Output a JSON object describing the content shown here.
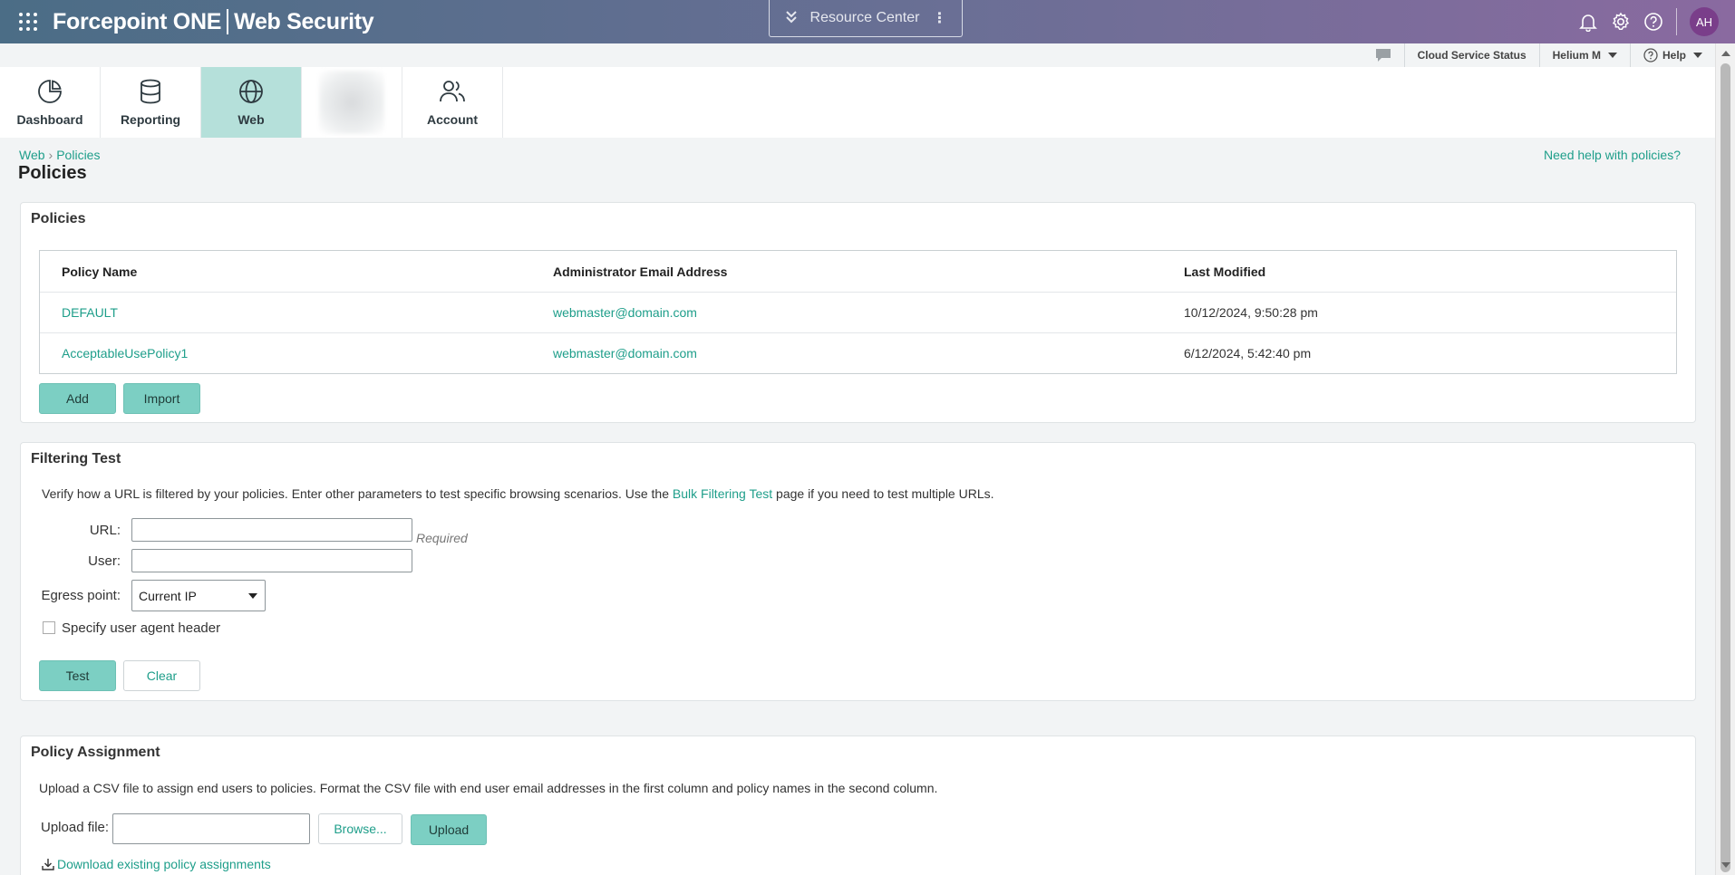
{
  "topbar": {
    "brand_left": "Forcepoint ONE",
    "brand_right": "Web Security",
    "resource_center": "Resource Center",
    "avatar_initials": "AH"
  },
  "utilbar": {
    "cloud_status": "Cloud Service Status",
    "user": "Helium M",
    "help": "Help"
  },
  "nav": {
    "dashboard": "Dashboard",
    "reporting": "Reporting",
    "web": "Web",
    "account": "Account"
  },
  "breadcrumb": {
    "web": "Web",
    "sep": "›",
    "policies": "Policies"
  },
  "page_title": "Policies",
  "help_link": "Need help with policies?",
  "policies_panel": {
    "title": "Policies",
    "columns": [
      "Policy Name",
      "Administrator Email Address",
      "Last Modified"
    ],
    "rows": [
      {
        "name": "DEFAULT",
        "email": "webmaster@domain.com",
        "modified": "10/12/2024, 9:50:28 pm"
      },
      {
        "name": "AcceptableUsePolicy1",
        "email": "webmaster@domain.com",
        "modified": "6/12/2024, 5:42:40 pm"
      }
    ],
    "add_label": "Add",
    "import_label": "Import"
  },
  "filtering_test": {
    "title": "Filtering Test",
    "desc_before": "Verify how a URL is filtered by your policies. Enter other parameters to test specific browsing scenarios. Use the ",
    "desc_link": "Bulk Filtering Test",
    "desc_after": " page if you need to test multiple URLs.",
    "url_label": "URL:",
    "url_value": "",
    "required": "Required",
    "user_label": "User:",
    "user_value": "",
    "egress_label": "Egress point:",
    "egress_value": "Current IP",
    "ua_label": "Specify user agent header",
    "test_label": "Test",
    "clear_label": "Clear"
  },
  "policy_assignment": {
    "title": "Policy Assignment",
    "desc": "Upload a CSV file to assign end users to policies. Format the CSV file with end user email addresses in the first column and policy names in the second column.",
    "upload_label": "Upload file:",
    "file_value": "",
    "browse_label": "Browse...",
    "upload_button": "Upload",
    "download_link": "Download existing policy assignments"
  }
}
